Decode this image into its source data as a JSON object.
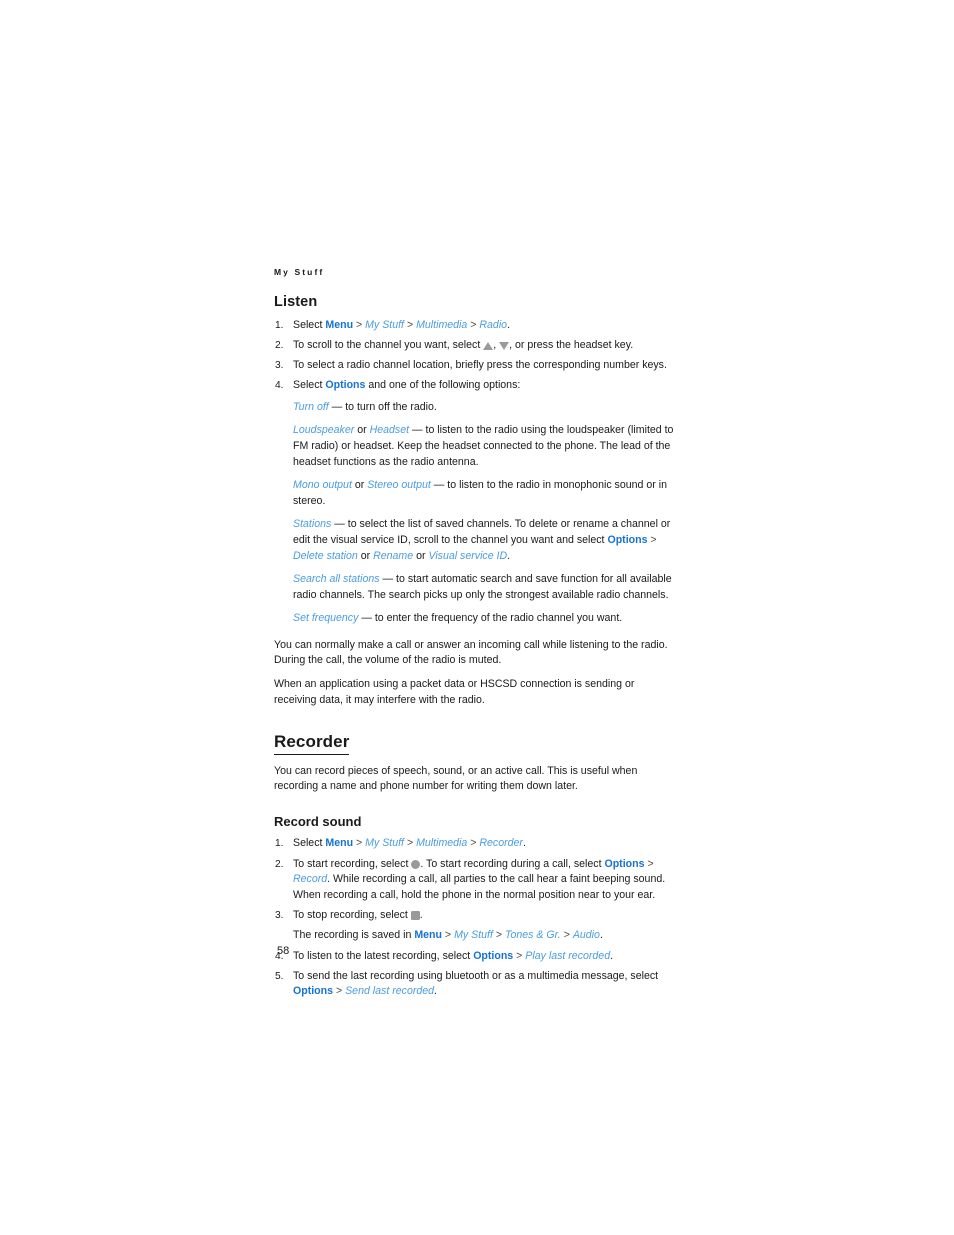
{
  "document": {
    "running_header": "My Stuff",
    "page_number": "58",
    "colors": {
      "command_blue": "#1473d3",
      "nav_blue": "#4a9de0",
      "text": "#1a1a1a",
      "icon_gray": "#9a9a9a"
    }
  },
  "listen": {
    "heading": "Listen",
    "steps": {
      "n1": "1.",
      "n2": "2.",
      "n3": "3.",
      "n4": "4."
    },
    "step1": {
      "lead": "Select ",
      "menu": "Menu",
      "sep1": " > ",
      "my_stuff": "My Stuff",
      "sep2": " > ",
      "multimedia": "Multimedia",
      "sep3": " > ",
      "radio": "Radio",
      "end": "."
    },
    "step2": {
      "lead": "To scroll to the channel you want, select ",
      "mid": ", ",
      "tail": ", or press the headset key.",
      "icon_up": "scroll-up-icon",
      "icon_down": "scroll-down-icon"
    },
    "step3": "To select a radio channel location, briefly press the corresponding number keys.",
    "step4": {
      "lead": "Select ",
      "options": "Options",
      "tail": " and one of the following options:"
    },
    "options": {
      "turn_off": {
        "term": "Turn off",
        "desc": " — to turn off the radio."
      },
      "loudspeaker": {
        "term1": "Loudspeaker",
        "joiner": " or ",
        "term2": "Headset",
        "desc": " — to listen to the radio using the loudspeaker (limited to FM radio) or headset. Keep the headset connected to the phone. The lead of the headset functions as the radio antenna."
      },
      "mono": {
        "term1": "Mono output",
        "joiner": " or ",
        "term2": "Stereo output",
        "desc": " — to listen to the radio in monophonic sound or in stereo."
      },
      "stations": {
        "term": "Stations",
        "desc1": " — to select the list of saved channels. To delete or rename a channel or edit the visual service ID, scroll to the channel you want and select ",
        "options_cmd": "Options",
        "sep1": " > ",
        "delete_station": "Delete station",
        "or1": " or ",
        "rename": "Rename",
        "or2": " or ",
        "visual_service_id": "Visual service ID",
        "end": "."
      },
      "search_all": {
        "term": "Search all stations",
        "desc": " — to start automatic search and save function for all available radio channels. The search picks up only the strongest available radio channels."
      },
      "set_frequency": {
        "term": "Set frequency",
        "desc": " — to enter the frequency of the radio channel you want."
      }
    },
    "note1": "You can normally make a call or answer an incoming call while listening to the radio. During the call, the volume of the radio is muted.",
    "note2": "When an application using a packet data or HSCSD connection is sending or receiving data, it may interfere with the radio."
  },
  "recorder": {
    "heading": "Recorder",
    "intro": "You can record pieces of speech, sound, or an active call. This is useful when recording a name and phone number for writing them down later.",
    "record_sound": {
      "heading": "Record sound",
      "steps": {
        "n1": "1.",
        "n2": "2.",
        "n3": "3.",
        "n4": "4.",
        "n5": "5."
      },
      "step1": {
        "lead": "Select ",
        "menu": "Menu",
        "sep1": " > ",
        "my_stuff": "My Stuff",
        "sep2": " > ",
        "multimedia": "Multimedia",
        "sep3": " > ",
        "recorder": "Recorder",
        "end": "."
      },
      "step2": {
        "lead": "To start recording, select ",
        "mid": ". To start recording during a call, select ",
        "options": "Options",
        "sep": " > ",
        "record": "Record",
        "tail": ". While recording a call, all parties to the call hear a faint beeping sound. When recording a call, hold the phone in the normal position near to your ear.",
        "icon_record": "record-icon"
      },
      "step3": {
        "lead": "To stop recording, select ",
        "tail": ".",
        "icon_stop": "stop-icon"
      },
      "step3_note": {
        "lead": "The recording is saved in ",
        "menu": "Menu",
        "sep1": " > ",
        "my_stuff": "My Stuff",
        "sep2": " > ",
        "tones": "Tones & Gr.",
        "sep3": " > ",
        "audio": "Audio",
        "end": "."
      },
      "step4": {
        "lead": "To listen to the latest recording, select ",
        "options": "Options",
        "sep": " > ",
        "play_last": "Play last recorded",
        "end": "."
      },
      "step5": {
        "lead": "To send the last recording using bluetooth or as a multimedia message, select ",
        "options": "Options",
        "sep": " > ",
        "send_last": "Send last recorded",
        "end": "."
      }
    }
  }
}
